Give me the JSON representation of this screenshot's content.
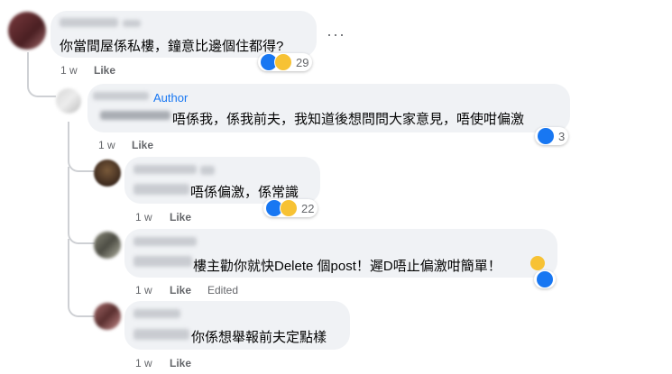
{
  "comments": [
    {
      "text": "你當間屋係私樓，鐘意比邊個住都得?",
      "time": "1 w",
      "like_label": "Like",
      "reaction_count": "29",
      "reactions": [
        "like-icon",
        "haha-icon"
      ]
    },
    {
      "author_badge": "Author",
      "text": "唔係我，係我前夫，我知道後想問問大家意見，唔使咁偏激",
      "time": "1 w",
      "like_label": "Like",
      "reaction_count": "3",
      "reactions": [
        "like-icon"
      ]
    },
    {
      "text": "唔係偏激，係常識",
      "time": "1 w",
      "like_label": "Like",
      "reaction_count": "22",
      "reactions": [
        "like-icon",
        "haha-icon"
      ]
    },
    {
      "text": "樓主勸你就快Delete 個post！遲D唔止偏激咁簡單！",
      "time": "1 w",
      "like_label": "Like",
      "edited_label": "Edited",
      "reactions": [
        "like-icon"
      ]
    },
    {
      "text": "你係想舉報前夫定點樣",
      "time": "1 w",
      "like_label": "Like"
    }
  ],
  "more_options": "···",
  "colors": {
    "bubble": "#f0f2f5",
    "accent": "#1877f2",
    "meta": "#65676b"
  }
}
